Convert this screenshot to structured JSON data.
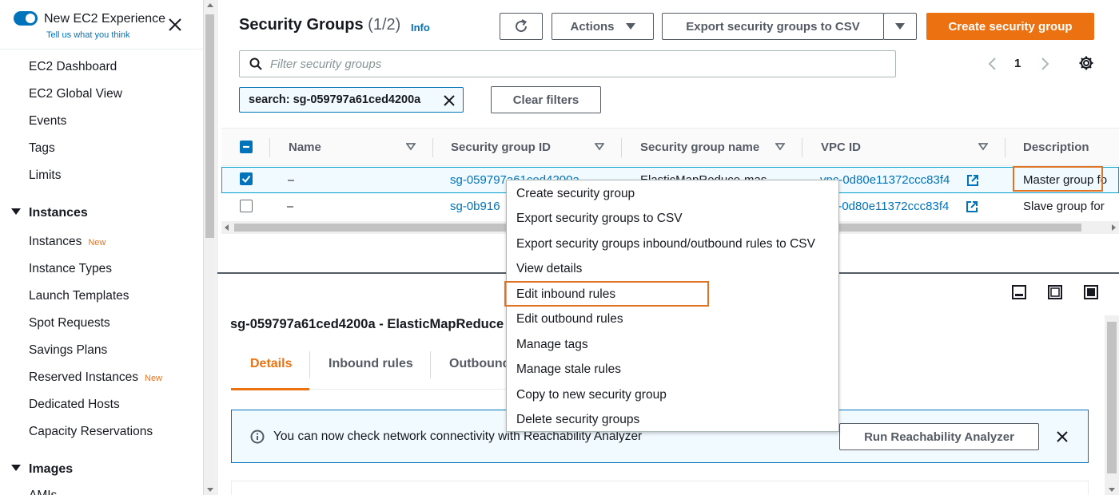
{
  "sidebar": {
    "experience_title": "New EC2 Experience",
    "experience_subtitle": "Tell us what you think",
    "items": [
      {
        "label": "EC2 Dashboard"
      },
      {
        "label": "EC2 Global View"
      },
      {
        "label": "Events"
      },
      {
        "label": "Tags"
      },
      {
        "label": "Limits"
      }
    ],
    "sections": [
      {
        "title": "Instances",
        "items": [
          {
            "label": "Instances",
            "badge": "New"
          },
          {
            "label": "Instance Types"
          },
          {
            "label": "Launch Templates"
          },
          {
            "label": "Spot Requests"
          },
          {
            "label": "Savings Plans"
          },
          {
            "label": "Reserved Instances",
            "badge": "New"
          },
          {
            "label": "Dedicated Hosts"
          },
          {
            "label": "Capacity Reservations"
          }
        ]
      },
      {
        "title": "Images",
        "items": [
          {
            "label": "AMIs"
          }
        ]
      }
    ]
  },
  "header": {
    "title": "Security Groups",
    "count": "(1/2)",
    "info": "Info",
    "actions_label": "Actions",
    "export_label": "Export security groups to CSV",
    "create_label": "Create security group"
  },
  "filter": {
    "placeholder": "Filter security groups",
    "token": "search: sg-059797a61ced4200a",
    "clear_label": "Clear filters"
  },
  "pagination": {
    "page": "1"
  },
  "table": {
    "columns": [
      "Name",
      "Security group ID",
      "Security group name",
      "VPC ID",
      "Description"
    ],
    "rows": [
      {
        "name": "–",
        "id": "sg-059797a61ced4200a",
        "group_name": "ElasticMapReduce-mas",
        "vpc": "vpc-0d80e11372ccc83f4",
        "description": "Master group fo",
        "selected": true
      },
      {
        "name": "–",
        "id": "sg-0b916",
        "group_name": "",
        "vpc": "vpc-0d80e11372ccc83f4",
        "description": "Slave group for",
        "selected": false
      }
    ]
  },
  "details": {
    "title": "sg-059797a61ced4200a - ElasticMapReduce",
    "tabs": [
      "Details",
      "Inbound rules",
      "Outbound"
    ],
    "alert_text": "You can now check network connectivity with Reachability Analyzer",
    "alert_button": "Run Reachability Analyzer"
  },
  "context_menu": {
    "items": [
      "Create security group",
      "Export security groups to CSV",
      "Export security groups inbound/outbound rules to CSV",
      "View details",
      "Edit inbound rules",
      "Edit outbound rules",
      "Manage tags",
      "Manage stale rules",
      "Copy to new security group",
      "Delete security groups"
    ],
    "highlighted": "Edit inbound rules"
  },
  "colors": {
    "accent": "#ec7211",
    "link": "#0073bb",
    "highlight_box": "#e07424"
  }
}
